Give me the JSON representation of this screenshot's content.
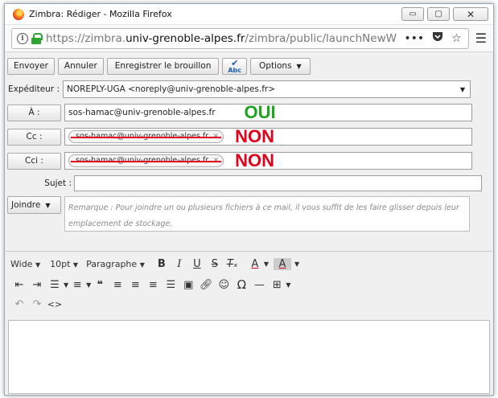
{
  "window": {
    "title": "Zimbra: Rédiger - Mozilla Firefox",
    "minimize": "▭",
    "maximize": "▢",
    "close": "✕"
  },
  "urlbar": {
    "url_prefix": "https://zimbra.",
    "url_domain": "univ-grenoble-alpes.fr",
    "url_path": "/zimbra/public/launchNewW",
    "more": "•••"
  },
  "toolbar": {
    "send": "Envoyer",
    "cancel": "Annuler",
    "save_draft": "Enregistrer le brouillon",
    "spell_label": "Abc",
    "options": "Options"
  },
  "compose": {
    "from_label": "Expéditeur :",
    "from_value": "NOREPLY-UGA <noreply@univ-grenoble-alpes.fr>",
    "to_button": "À :",
    "to_value": "sos-hamac@univ-grenoble-alpes.fr",
    "to_mark": "OUI",
    "cc_button": "Cc :",
    "cc_bubble": "sos-hamac@univ-grenoble-alpes.fr",
    "cc_mark": "NON",
    "bcc_button": "Cci :",
    "bcc_bubble": "sos-hamac@univ-grenoble-alpes.fr",
    "bcc_mark": "NON",
    "subject_label": "Sujet :",
    "subject_value": "",
    "attach_button": "Joindre",
    "attach_hint": "Remarque : Pour joindre un ou plusieurs fichiers à ce mail, il vous suffit de les faire glisser depuis leur emplacement de stockage."
  },
  "editor": {
    "width_label": "Wide",
    "font_size": "10pt",
    "format": "Paragraphe",
    "text_color": "A",
    "bg_color": "A"
  },
  "colors": {
    "oui": "#1fa21f",
    "non": "#e2001a",
    "lock": "#2ea52e"
  }
}
